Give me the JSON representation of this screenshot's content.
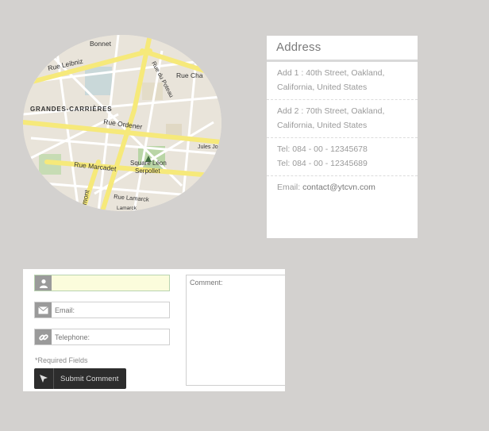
{
  "map": {
    "labels": {
      "bonnet": "Bonnet",
      "rue_leibniz": "Rue Leibniz",
      "rue_du_poteau": "Rue du Poteau",
      "rue_cha": "Rue Cha",
      "grandes_carrieres": "GRANDES-CARRIÈRES",
      "rue_ordener": "Rue Ordener",
      "jules_jo": "Jules Jo",
      "square_leon": "Square Léon",
      "serpollet": "Serpollet",
      "rue_marcadet": "Rue Marcadet",
      "remont": "remont",
      "rue_lamarck": "Rue Lamarck",
      "lamarck": "Lamarck"
    }
  },
  "address": {
    "title": "Address",
    "add1_line1": "Add 1 : 40th Street, Oakland,",
    "add1_line2": "California, United States",
    "add2_line1": "Add 2 : 70th Street, Oakland,",
    "add2_line2": "California, United States",
    "tel1": "Tel: 084 - 00 - 12345678",
    "tel2": "Tel: 084 - 00 - 12345689",
    "email_label": "Email: ",
    "email_value": "contact@ytcvn.com"
  },
  "form": {
    "name_placeholder": "",
    "email_placeholder": "Email:",
    "phone_placeholder": "Telephone:",
    "comment_placeholder": "Comment:",
    "required_note": "*Required Fields",
    "submit_label": "Submit Comment"
  },
  "icons": {
    "name": "user-icon",
    "email": "envelope-icon",
    "phone": "link-icon",
    "submit": "cursor-arrow-icon"
  }
}
